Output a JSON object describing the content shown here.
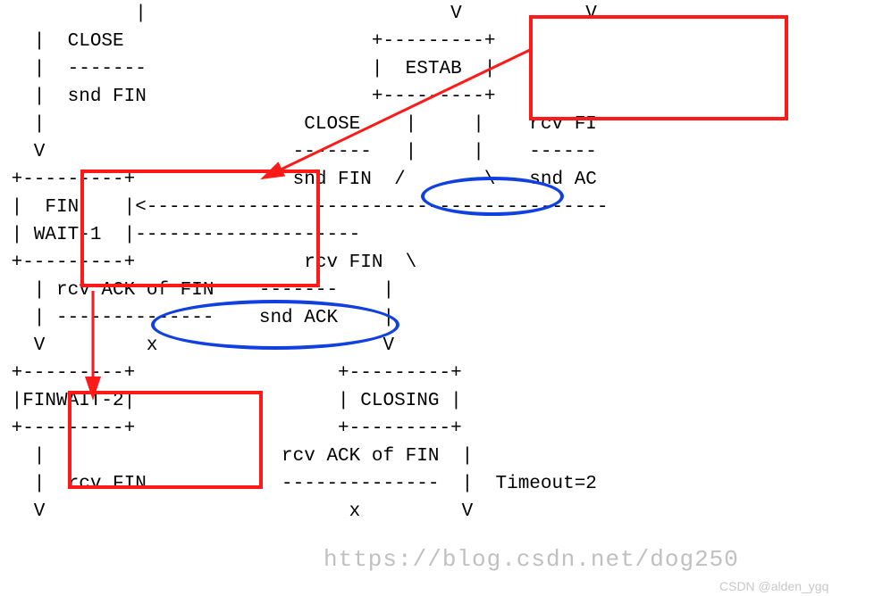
{
  "ascii": "            |                           V           V\n   |  CLOSE                      +---------+\n   |  -------                    |  ESTAB  |\n   |  snd FIN                    +---------+\n   |                       CLOSE    |     |    rcv FI\n   V                      -------   |     |    ------\n +---------+              snd FIN  /       \\   snd AC\n |  FIN    |<-----------------------------------------\n | WAIT-1  |--------------------\n +---------+               rcv FIN  \\\n   | rcv ACK of FIN    -------    |\n   | --------------    snd ACK    |\n   V         x                    V\n +---------+                  +---------+\n |FINWAIT-2|                  | CLOSING |\n +---------+                  +---------+\n   |                     rcv ACK of FIN  |\n   |  rcv FIN            --------------  |  Timeout=2\n   V                           x         V",
  "states": {
    "estab": "ESTAB",
    "finwait1_a": "FIN",
    "finwait1_b": "WAIT-1",
    "finwait2": "FINWAIT-2",
    "closing": "CLOSING"
  },
  "events": {
    "close": "CLOSE",
    "snd_fin": "snd FIN",
    "rcv_fin": "rcv FIN",
    "rcv_fi": "rcv FI",
    "snd_ack": "snd ACK",
    "snd_ac": "snd AC",
    "rcv_ack_of_fin": "rcv ACK of FIN",
    "timeout": "Timeout=2"
  },
  "watermark": {
    "url": "https://blog.csdn.net/dog250",
    "credit": "CSDN @alden_ygq"
  },
  "colors": {
    "red": "#ff1a1a",
    "blue": "#1040e0"
  }
}
